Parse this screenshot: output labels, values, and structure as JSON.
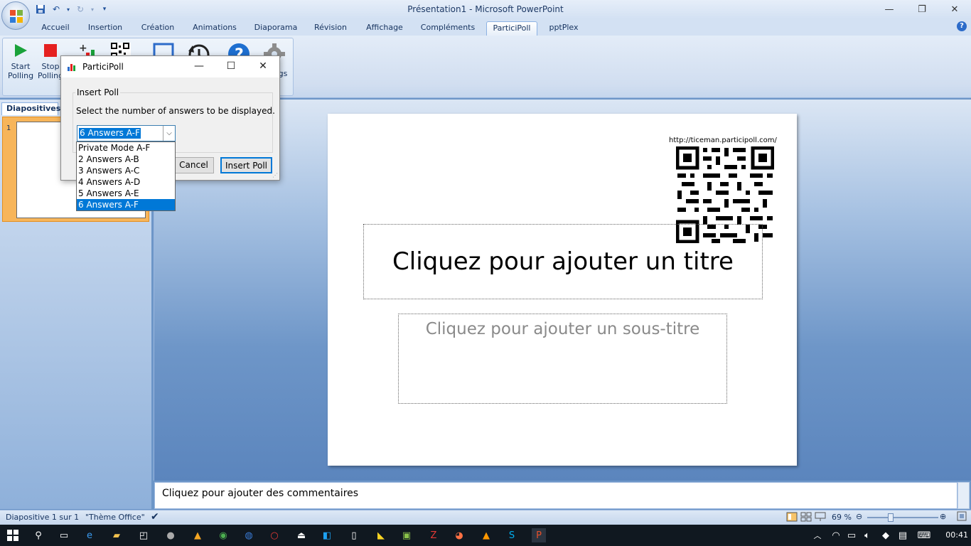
{
  "window": {
    "title": "Présentation1 - Microsoft PowerPoint",
    "minimize": "—",
    "restore": "❐",
    "close": "✕"
  },
  "tabs": [
    {
      "label": "Accueil"
    },
    {
      "label": "Insertion"
    },
    {
      "label": "Création"
    },
    {
      "label": "Animations"
    },
    {
      "label": "Diaporama"
    },
    {
      "label": "Révision"
    },
    {
      "label": "Affichage"
    },
    {
      "label": "Compléments"
    },
    {
      "label": "ParticiPoll"
    },
    {
      "label": "pptPlex"
    }
  ],
  "active_tab": "ParticiPoll",
  "ribbon": {
    "start_polling": "Start Polling",
    "stop_polling": "Stop Polling",
    "settings_partial": "gs"
  },
  "left_panel": {
    "tab_label": "Diapositives",
    "slide_number": "1"
  },
  "slide": {
    "qr_url": "http://ticeman.participoll.com/",
    "title_placeholder": "Cliquez pour ajouter un titre",
    "subtitle_placeholder": "Cliquez pour ajouter un sous-titre"
  },
  "notes": {
    "placeholder": "Cliquez pour ajouter des commentaires"
  },
  "statusbar": {
    "slide_info": "Diapositive 1 sur 1",
    "theme": "\"Thème Office\"",
    "zoom": "69 %"
  },
  "dialog": {
    "title": "ParticiPoll",
    "group_label": "Insert Poll",
    "instruction": "Select the number of answers to be displayed.",
    "selected": "6 Answers A-F",
    "options": [
      "Private Mode A-F",
      "2 Answers A-B",
      "3 Answers A-C",
      "4 Answers A-D",
      "5 Answers A-E",
      "6 Answers A-F"
    ],
    "cancel": "Cancel",
    "insert": "Insert Poll"
  },
  "taskbar": {
    "clock": "00:41"
  },
  "colors": {
    "ribbon_bg": "#d3e1f3",
    "selection": "#0078d7",
    "thumb_highlight": "#f7b55a",
    "taskbar": "#101820"
  }
}
